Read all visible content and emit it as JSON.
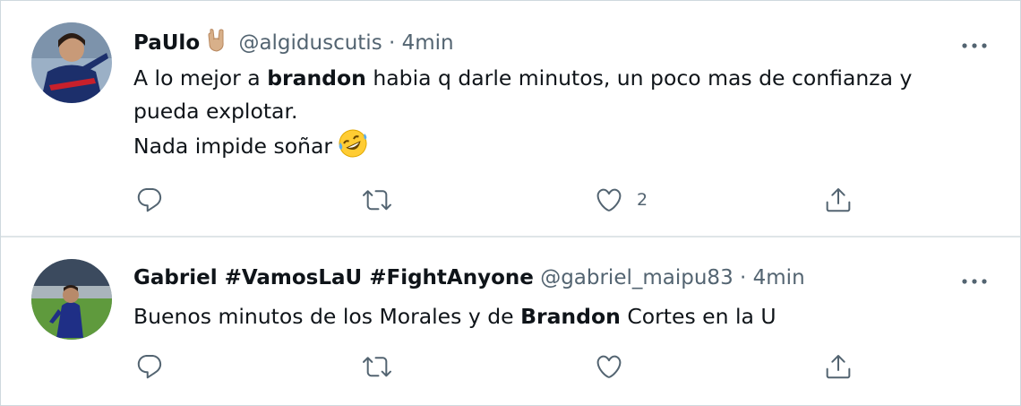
{
  "tweets": [
    {
      "name": "PaUlo",
      "handle": "@algiduscutis",
      "separator": "·",
      "time": "4min",
      "body": {
        "line1_pre": "A lo mejor a ",
        "line1_bold": "brandon",
        "line1_post": " habia q darle minutos, un poco mas de confianza y",
        "line2": "pueda explotar.",
        "line3": "Nada impide soñar"
      },
      "actions": {
        "reply_count": "",
        "retweet_count": "",
        "like_count": "2"
      }
    },
    {
      "name": "Gabriel #VamosLaU #FightAnyone",
      "handle": "@gabriel_maipu83",
      "separator": "·",
      "time": "4min",
      "body": {
        "pre": "Buenos minutos de los Morales y de ",
        "bold": "Brandon",
        "post": " Cortes en la U"
      },
      "actions": {
        "reply_count": "",
        "retweet_count": "",
        "like_count": ""
      }
    }
  ],
  "icons": {
    "reply": "reply-icon",
    "retweet": "retweet-icon",
    "like": "heart-icon",
    "share": "share-icon",
    "more": "more-icon"
  },
  "colors": {
    "text": "#0f1419",
    "secondary": "#536471",
    "border": "#cfd9de"
  }
}
